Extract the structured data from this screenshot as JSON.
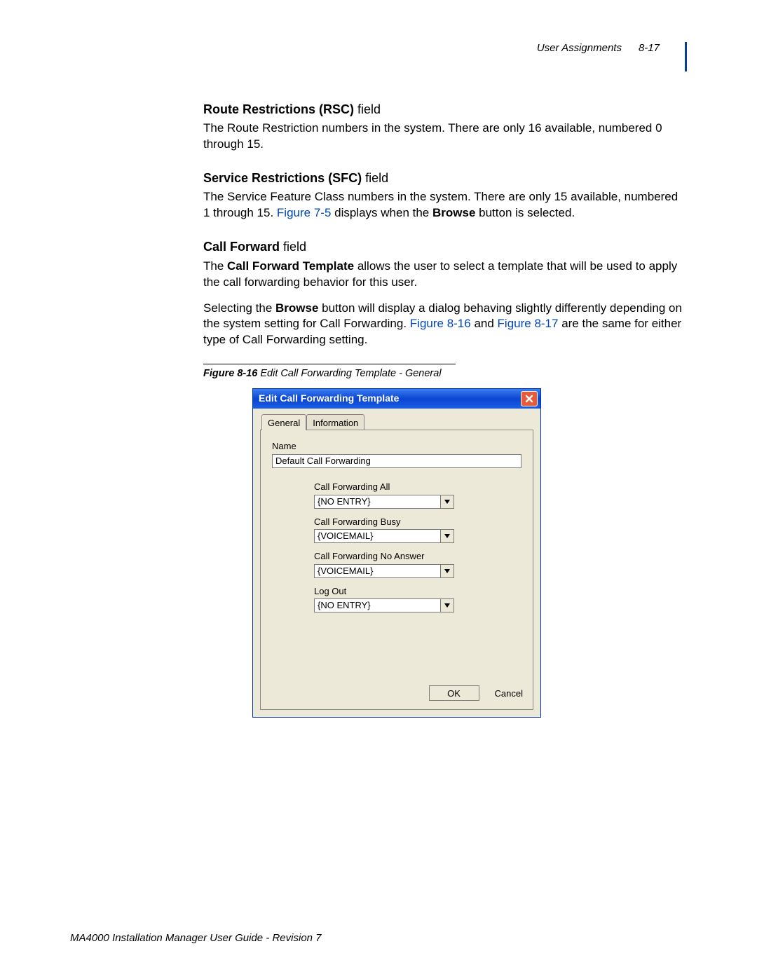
{
  "header": {
    "section": "User Assignments",
    "pagenum": "8-17"
  },
  "sections": {
    "rsc": {
      "title_bold": "Route Restrictions (RSC)",
      "title_light": " field",
      "body": "The Route Restriction numbers in the system. There are only 16 available, numbered 0 through 15."
    },
    "sfc": {
      "title_bold": "Service Restrictions (SFC)",
      "title_light": " field",
      "body_pre": "The Service Feature Class numbers in the system. There are only 15 available, numbered 1 through 15. ",
      "xref": "Figure 7-5",
      "body_post": " displays when the ",
      "bold": "Browse",
      "tail": " button is selected."
    },
    "cf": {
      "title_bold": "Call Forward",
      "title_light": " field",
      "p1_pre": "The ",
      "p1_bold": "Call Forward Template",
      "p1_post": " allows the user to select a template that will be used to apply the call forwarding behavior for this user.",
      "p2_pre": "Selecting the ",
      "p2_bold": "Browse",
      "p2_mid": " button will display a dialog behaving slightly differently depending on the system setting for Call Forwarding. ",
      "p2_x1": "Figure 8-16",
      "p2_and": " and ",
      "p2_x2": "Figure 8-17",
      "p2_tail": " are the same for either type of Call Forwarding setting."
    }
  },
  "figure": {
    "label": "Figure 8-16",
    "caption": "  Edit Call Forwarding Template - General"
  },
  "dialog": {
    "title": "Edit Call Forwarding Template",
    "tabs": {
      "general": "General",
      "information": "Information"
    },
    "name_label": "Name",
    "name_value": "Default Call Forwarding",
    "fields": [
      {
        "label": "Call Forwarding All",
        "value": "{NO ENTRY}"
      },
      {
        "label": "Call Forwarding Busy",
        "value": "{VOICEMAIL}"
      },
      {
        "label": "Call Forwarding No Answer",
        "value": "{VOICEMAIL}"
      },
      {
        "label": "Log Out",
        "value": "{NO ENTRY}"
      }
    ],
    "ok": "OK",
    "cancel": "Cancel"
  },
  "footer": "MA4000 Installation Manager User Guide - Revision 7"
}
